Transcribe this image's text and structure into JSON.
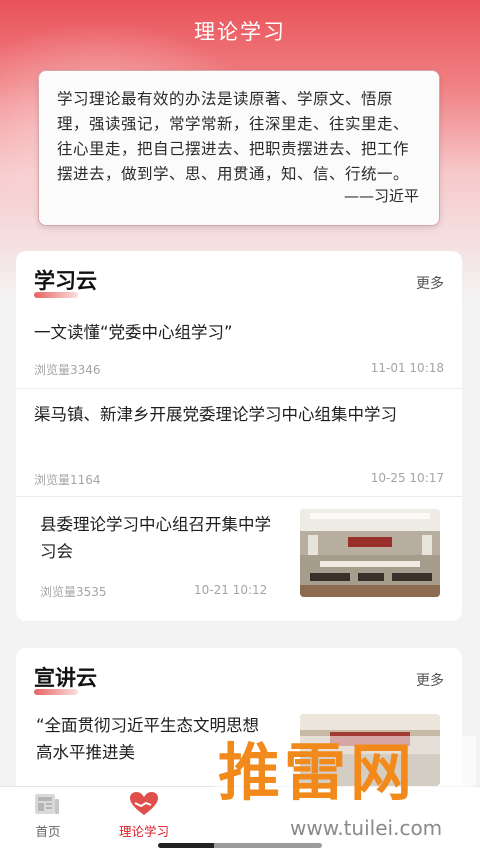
{
  "header": {
    "title": "理论学习"
  },
  "quote": {
    "text": "学习理论最有效的办法是读原著、学原文、悟原理，强读强记，常学常新，往深里走、往实里走、往心里走，把自己摆进去、把职责摆进去、把工作摆进去，做到学、思、用贯通，知、信、行统一。",
    "author": "——习近平"
  },
  "study_cloud": {
    "title": "学习云",
    "more": "更多",
    "items": [
      {
        "title": "一文读懂“党委中心组学习”",
        "views": "浏览量3346",
        "time": "11-01 10:18"
      },
      {
        "title": "渠马镇、新津乡开展党委理论学习中心组集中学习",
        "views": "浏览量1164",
        "time": "10-25 10:17"
      },
      {
        "title": "县委理论学习中心组召开集中学习会",
        "views": "浏览量3535",
        "time": "10-21 10:12"
      }
    ]
  },
  "lecture_cloud": {
    "title": "宣讲云",
    "more": "更多",
    "items": [
      {
        "title": "“全面贯彻习近平生态文明思想 高水平推进美"
      }
    ]
  },
  "tabbar": {
    "items": [
      {
        "label": "首页",
        "icon": "newspaper-icon",
        "active": false
      },
      {
        "label": "理论学习",
        "icon": "heart-hands-icon",
        "active": true
      }
    ]
  },
  "watermark": {
    "text": "推雷网",
    "url": "www.tuilei.com"
  },
  "colors": {
    "accent": "#d9202a",
    "watermark": "#f28a1b"
  }
}
